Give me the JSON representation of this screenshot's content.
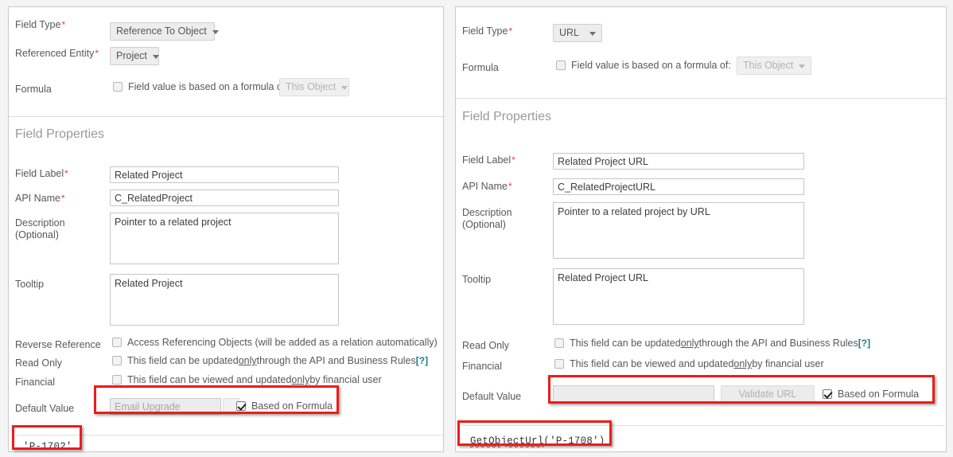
{
  "panels": [
    {
      "id": "left",
      "top_section": {
        "field_type": {
          "label": "Field Type",
          "required": "*",
          "value": "Reference To Object"
        },
        "referenced_entity": {
          "label": "Referenced Entity",
          "required": "*",
          "value": "Project"
        },
        "formula": {
          "label": "Formula",
          "checkbox_label": "Field value is based on a formula of:",
          "checked": false,
          "dropdown_value": "This Object",
          "dropdown_disabled": true
        }
      },
      "section_title": "Field Properties",
      "field_label": {
        "label": "Field Label",
        "required": "*",
        "value": "Related Project"
      },
      "api_name": {
        "label": "API Name",
        "required": "*",
        "value": "C_RelatedProject"
      },
      "description": {
        "label_line1": "Description",
        "label_line2": "(Optional)",
        "value": "Pointer to a related project"
      },
      "tooltip": {
        "label": "Tooltip",
        "value": "Related Project"
      },
      "reverse_reference": {
        "label": "Reverse Reference",
        "text_a": "Access Referencing Objects (will be added as a relation automatically)",
        "help": "[?]",
        "checked": false
      },
      "read_only": {
        "label": "Read Only",
        "text_a": "This field can be updated ",
        "text_only": "only",
        "text_b": " through the API and Business Rules ",
        "help": "[?]",
        "checked": false
      },
      "financial": {
        "label": "Financial",
        "text_a": "This field can be viewed and updated ",
        "text_only": "only",
        "text_b": " by financial user",
        "checked": false
      },
      "default_value": {
        "label": "Default Value",
        "input_value": "Email Upgrade",
        "input_disabled": true,
        "has_blank_button": true,
        "validate_button": "",
        "formula_checkbox_label": "Based on Formula",
        "formula_checked": true
      },
      "formula_expression": "'P-1702'",
      "formula_expression_plain": "'P-1702'",
      "formula_fn": "",
      "formula_args": ""
    },
    {
      "id": "right",
      "top_section": {
        "field_type": {
          "label": "Field Type",
          "required": "*",
          "value": "URL"
        },
        "formula": {
          "label": "Formula",
          "checkbox_label": "Field value is based on a formula of:",
          "checked": false,
          "dropdown_value": "This Object",
          "dropdown_disabled": true
        }
      },
      "section_title": "Field Properties",
      "field_label": {
        "label": "Field Label",
        "required": "*",
        "value": "Related Project URL"
      },
      "api_name": {
        "label": "API Name",
        "required": "*",
        "value": "C_RelatedProjectURL"
      },
      "description": {
        "label_line1": "Description",
        "label_line2": "(Optional)",
        "value": "Pointer to a related project by URL"
      },
      "tooltip": {
        "label": "Tooltip",
        "value": "Related Project URL"
      },
      "read_only": {
        "label": "Read Only",
        "text_a": "This field can be updated ",
        "text_only": "only",
        "text_b": " through the API and Business Rules ",
        "help": "[?]",
        "checked": false
      },
      "financial": {
        "label": "Financial",
        "text_a": "This field can be viewed and updated ",
        "text_only": "only",
        "text_b": " by financial user",
        "checked": false
      },
      "default_value": {
        "label": "Default Value",
        "input_value": "",
        "input_disabled": true,
        "has_blank_button": false,
        "validate_button": "Validate URL",
        "formula_checkbox_label": "Based on Formula",
        "formula_checked": true
      },
      "formula_expression": "GetObjectUrl('P-1708')",
      "formula_fn": "GetObjectUrl",
      "formula_args": "('P-1708')"
    }
  ],
  "colors": {
    "annotation": "#ee1c18",
    "required": "#e0483e",
    "help_link": "#16808c",
    "section_title": "#9a9a9a",
    "label": "#58585a"
  }
}
